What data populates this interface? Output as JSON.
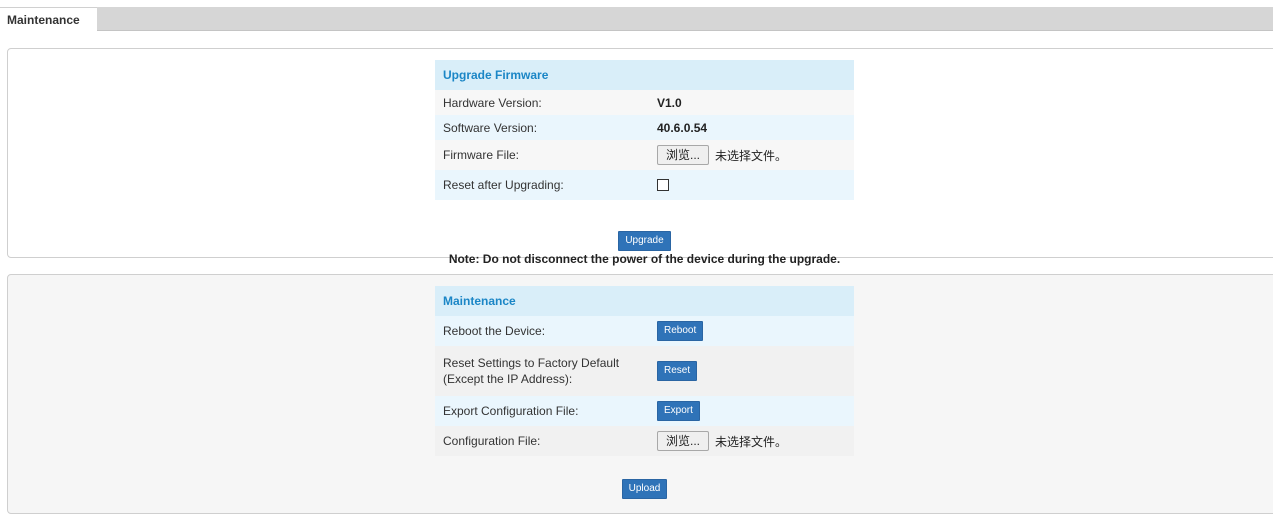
{
  "tabs": {
    "active_label": "Maintenance"
  },
  "upgrade": {
    "title": "Upgrade Firmware",
    "hardware_label": "Hardware Version:",
    "hardware_value": "V1.0",
    "software_label": "Software Version:",
    "software_value": "40.6.0.54",
    "firmware_label": "Firmware File:",
    "firmware_button": "浏览...",
    "firmware_status": "未选择文件。",
    "reset_label": "Reset after Upgrading:",
    "reset_checked": false,
    "upgrade_button": "Upgrade",
    "note": "Note: Do not disconnect the power of the device during the upgrade."
  },
  "maintenance": {
    "title": "Maintenance",
    "reboot_label": "Reboot the Device:",
    "reboot_button": "Reboot",
    "factory_label_line1": "Reset Settings to Factory Default",
    "factory_label_line2": "(Except the IP Address):",
    "reset_button": "Reset",
    "export_label": "Export Configuration File:",
    "export_button": "Export",
    "config_label": "Configuration File:",
    "config_button": "浏览...",
    "config_status": "未选择文件。",
    "upload_button": "Upload"
  },
  "colors": {
    "header_bg": "#d9eef9",
    "header_text": "#1b86c6",
    "button_blue": "#2f73b8"
  }
}
